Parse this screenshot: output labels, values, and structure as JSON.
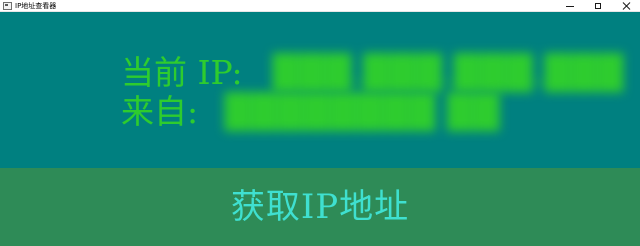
{
  "window": {
    "title": "IP地址查看器",
    "controls": {
      "minimize": "minimize",
      "maximize": "maximize",
      "close": "close"
    }
  },
  "info": {
    "ip_label": "当前 IP:",
    "ip_value": "███.███.███.███",
    "from_label": "来自:",
    "from_value": "████████ ██"
  },
  "action": {
    "fetch_label": "获取IP地址"
  },
  "colors": {
    "info_background": "#008080",
    "button_background": "#2e8b57",
    "label_text": "#2ecc2e",
    "button_text": "#3fe0d0"
  },
  "icons": {
    "app": "window-app-icon",
    "minimize": "minimize-icon",
    "maximize": "maximize-icon",
    "close": "close-icon"
  }
}
